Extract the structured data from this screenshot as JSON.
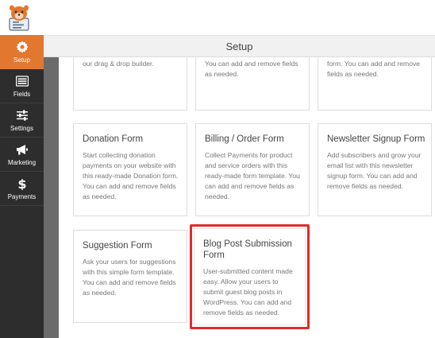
{
  "header": {
    "title": "Setup"
  },
  "sidebar": {
    "items": [
      {
        "label": "Setup",
        "icon": "gear-icon"
      },
      {
        "label": "Fields",
        "icon": "list-icon"
      },
      {
        "label": "Settings",
        "icon": "sliders-icon"
      },
      {
        "label": "Marketing",
        "icon": "megaphone-icon"
      },
      {
        "label": "Payments",
        "icon": "dollar-icon"
      }
    ]
  },
  "colors": {
    "accent": "#e27730",
    "sidebar": "#2d2d2d",
    "highlight": "#e02b2b"
  },
  "templates": [
    {
      "title": "",
      "desc": "create any type of form using our drag & drop builder."
    },
    {
      "title": "",
      "desc": "with this simple contact form. You can add and remove fields as needed."
    },
    {
      "title": "",
      "desc": "pre-made Request a quote form. You can add and remove fields as needed."
    },
    {
      "title": "Donation Form",
      "desc": "Start collecting donation payments on your website with this ready-made Donation form. You can add and remove fields as needed."
    },
    {
      "title": "Billing / Order Form",
      "desc": "Collect Payments for product and service orders with this ready-made form template. You can add and remove fields as needed."
    },
    {
      "title": "Newsletter Signup Form",
      "desc": "Add subscribers and grow your email list with this newsletter signup form. You can add and remove fields as needed."
    },
    {
      "title": "Suggestion Form",
      "desc": "Ask your users for suggestions with this simple form template. You can add and remove fields as needed."
    },
    {
      "title": "Blog Post Submission Form",
      "desc": "User-submitted content made easy. Allow your users to submit guest blog posts in WordPress. You can add and remove fields as needed."
    }
  ]
}
